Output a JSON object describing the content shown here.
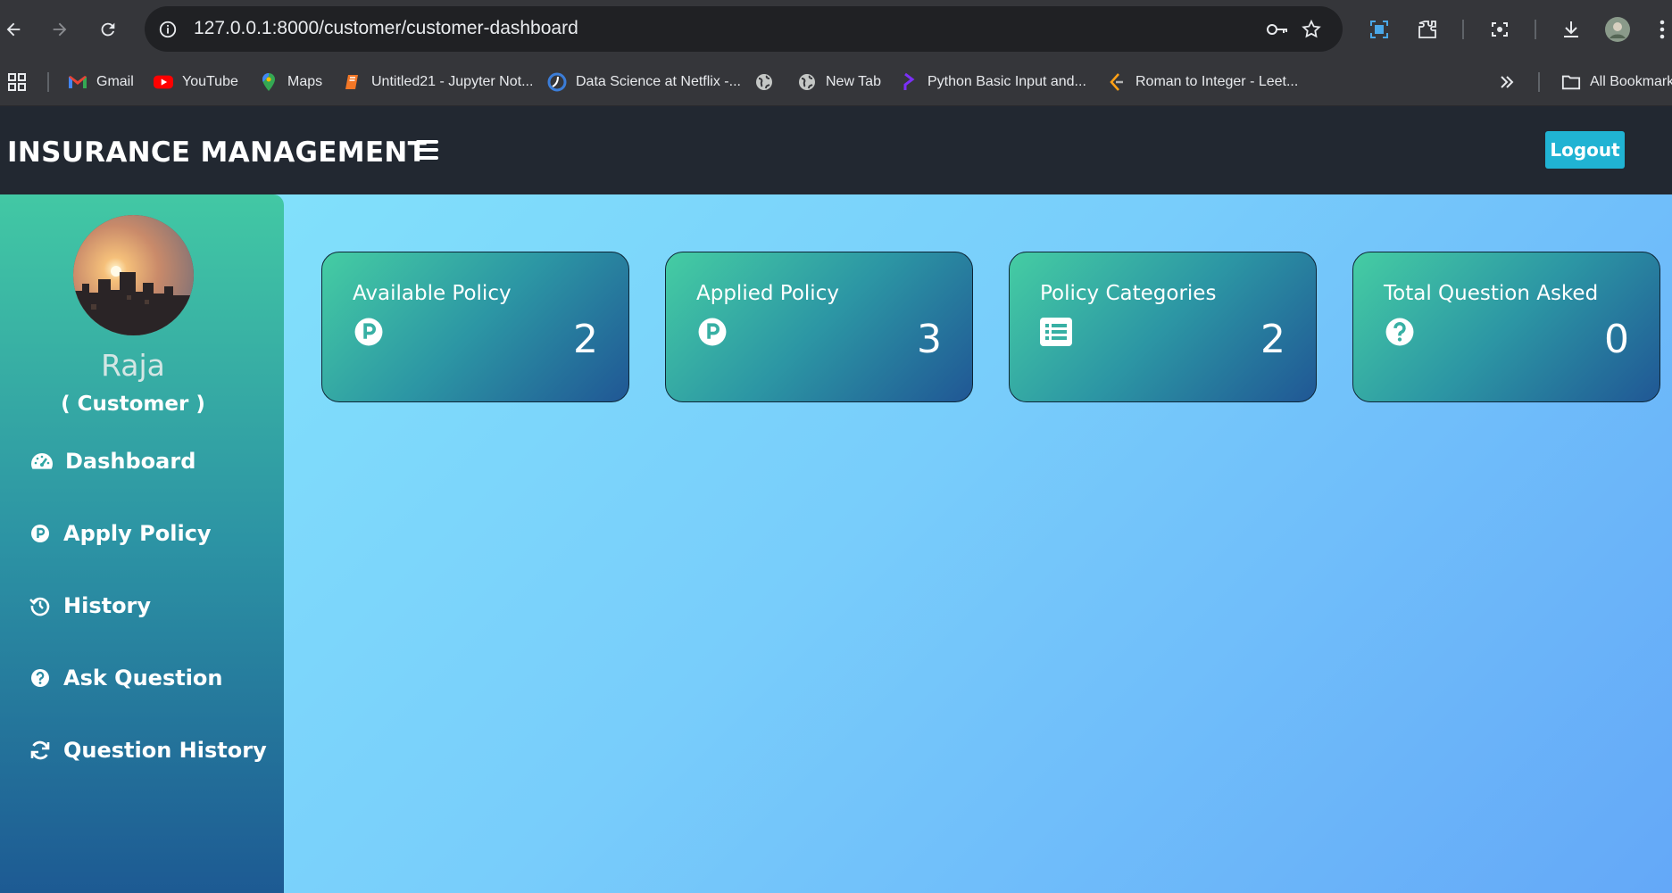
{
  "browser": {
    "url": "127.0.0.1:8000/customer/customer-dashboard",
    "bookmarks": [
      {
        "label": "Gmail",
        "icon": "gmail-icon"
      },
      {
        "label": "YouTube",
        "icon": "youtube-icon"
      },
      {
        "label": "Maps",
        "icon": "maps-icon"
      },
      {
        "label": "Untitled21 - Jupyter Not...",
        "icon": "jupyter-icon"
      },
      {
        "label": "Data Science at Netflix -...",
        "icon": "netflix-techblog-icon"
      },
      {
        "label": "",
        "icon": "globe-icon"
      },
      {
        "label": "New Tab",
        "icon": "globe-icon"
      },
      {
        "label": "Python Basic Input and...",
        "icon": "programiz-icon"
      },
      {
        "label": "Roman to Integer - Leet...",
        "icon": "leetcode-icon"
      }
    ],
    "all_bookmarks_label": "All Bookmark"
  },
  "app": {
    "brand": "INSURANCE MANAGEMENT",
    "logout_label": "Logout",
    "accent": "#20b3d3"
  },
  "user": {
    "name": "Raja",
    "role": "( Customer )"
  },
  "sidebar": {
    "items": [
      {
        "label": "Dashboard",
        "icon": "dashboard-icon"
      },
      {
        "label": "Apply Policy",
        "icon": "policy-icon"
      },
      {
        "label": "History",
        "icon": "history-icon"
      },
      {
        "label": "Ask Question",
        "icon": "question-icon"
      },
      {
        "label": "Question History",
        "icon": "refresh-icon"
      }
    ]
  },
  "cards": [
    {
      "title": "Available Policy",
      "value": "2",
      "icon": "policy-icon"
    },
    {
      "title": "Applied Policy",
      "value": "3",
      "icon": "policy-icon"
    },
    {
      "title": "Policy Categories",
      "value": "2",
      "icon": "list-icon"
    },
    {
      "title": "Total Question Asked",
      "value": "0",
      "icon": "question-icon"
    }
  ]
}
